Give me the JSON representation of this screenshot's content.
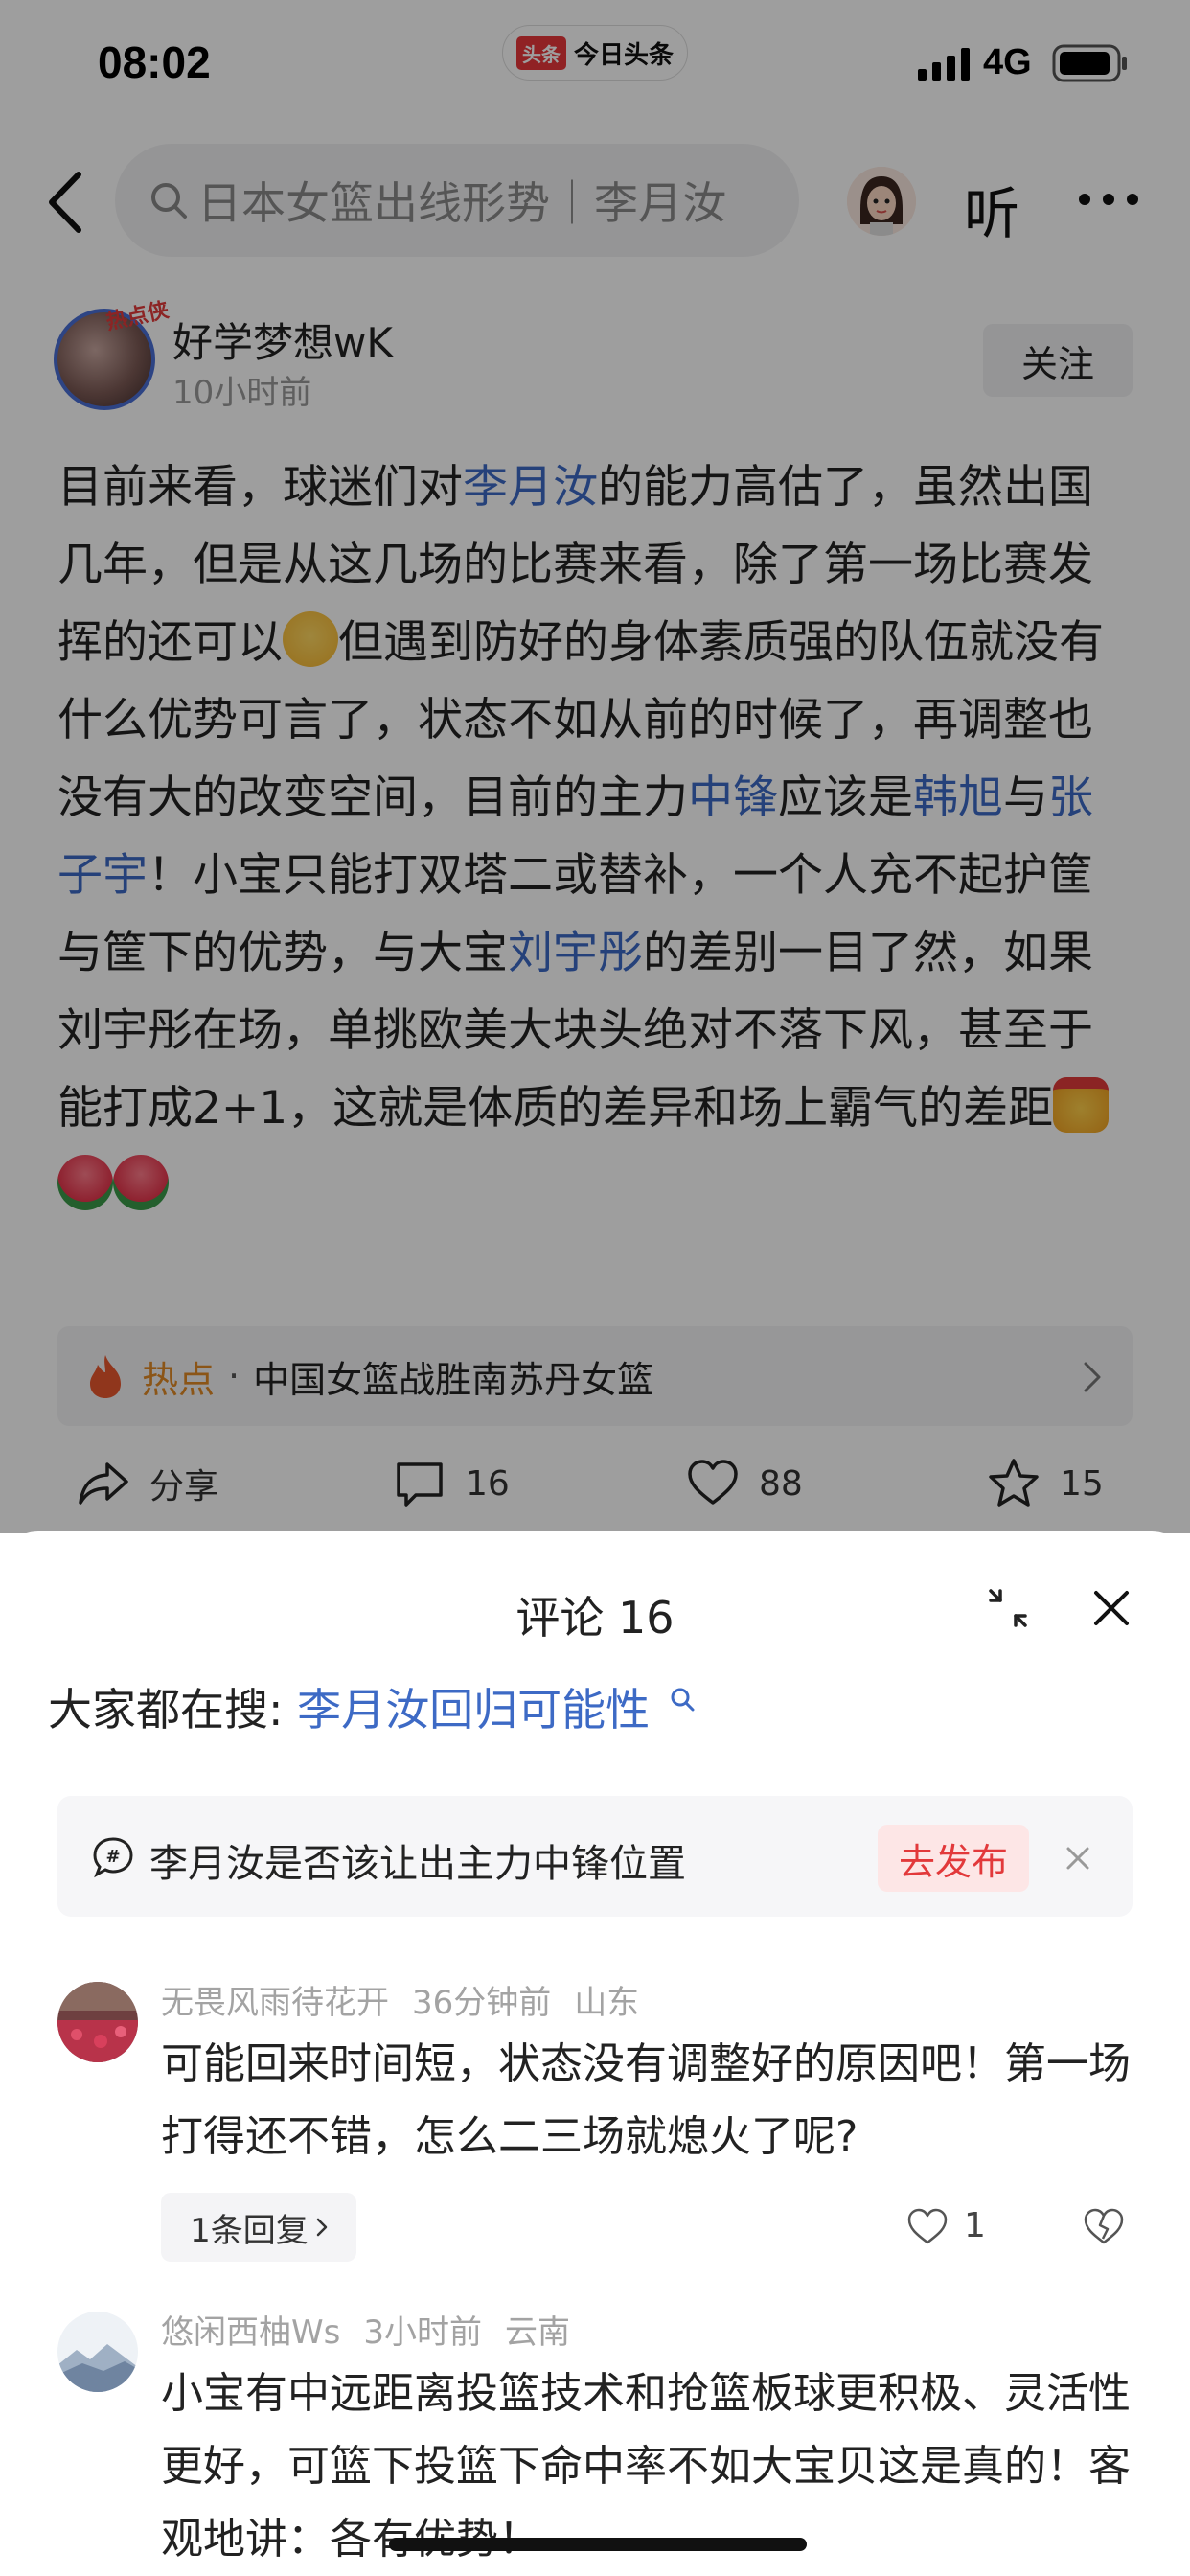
{
  "status_bar": {
    "time": "08:02",
    "app_badge": "头条",
    "app_name": "今日头条",
    "network": "4G"
  },
  "nav": {
    "search_text": "日本女篮出线形势｜李月汝",
    "listen_label": "听"
  },
  "post": {
    "author": "好学梦想wK",
    "avatar_tag": "热点侠",
    "time": "10小时前",
    "follow_label": "关注",
    "body": [
      {
        "t": "目前来看，球迷们对"
      },
      {
        "t": "李月汝",
        "link": true
      },
      {
        "t": "的能力高估了，虽然出国几年，但是从这几场的比赛来看，除了第一场比赛发挥的还可以"
      },
      {
        "emoji": "relieved"
      },
      {
        "t": "但遇到防好的身体素质强的队伍就没有什么优势可言了，状态不如从前的时候了，再调整也没有大的改变空间，目前的主力"
      },
      {
        "t": "中锋",
        "link": true
      },
      {
        "t": "应该是"
      },
      {
        "t": "韩旭",
        "link": true
      },
      {
        "t": "与"
      },
      {
        "t": "张子宇",
        "link": true
      },
      {
        "t": "！小宝只能打双塔二或替补，一个人充不起护筐与筐下的优势，与大宝"
      },
      {
        "t": "刘宇彤",
        "link": true
      },
      {
        "t": "的差别一目了然，如果刘宇彤在场，单挑欧美大块头绝对不落下风，甚至于能打成2+1，这就是体质的差异和场上霸气的差距"
      },
      {
        "emoji": "angry"
      },
      {
        "emoji": "rose"
      },
      {
        "emoji": "rose"
      }
    ],
    "hot": {
      "label": "热点",
      "dot": "·",
      "title": "中国女篮战胜南苏丹女篮"
    },
    "actions": {
      "share": "分享",
      "comments": "16",
      "likes": "88",
      "favorites": "15"
    }
  },
  "comments_sheet": {
    "title": "评论 16",
    "trend_prefix": "大家都在搜:",
    "trend_link": "李月汝回归可能性",
    "prompt_text": "李月汝是否该让出主力中锋位置",
    "publish_label": "去发布",
    "comments": [
      {
        "user": "无畏风雨待花开",
        "time": "36分钟前",
        "location": "山东",
        "text": "可能回来时间短，状态没有调整好的原因吧！第一场打得还不错，怎么二三场就熄火了呢?",
        "reply_label": "1条回复",
        "likes": "1"
      },
      {
        "user": "悠闲西柚Ws",
        "time": "3小时前",
        "location": "云南",
        "text": "小宝有中远距离投篮技术和抢篮板球更积极、灵活性更好，可篮下投篮下命中率不如大宝贝这是真的！客观地讲：各有优势！"
      }
    ]
  }
}
